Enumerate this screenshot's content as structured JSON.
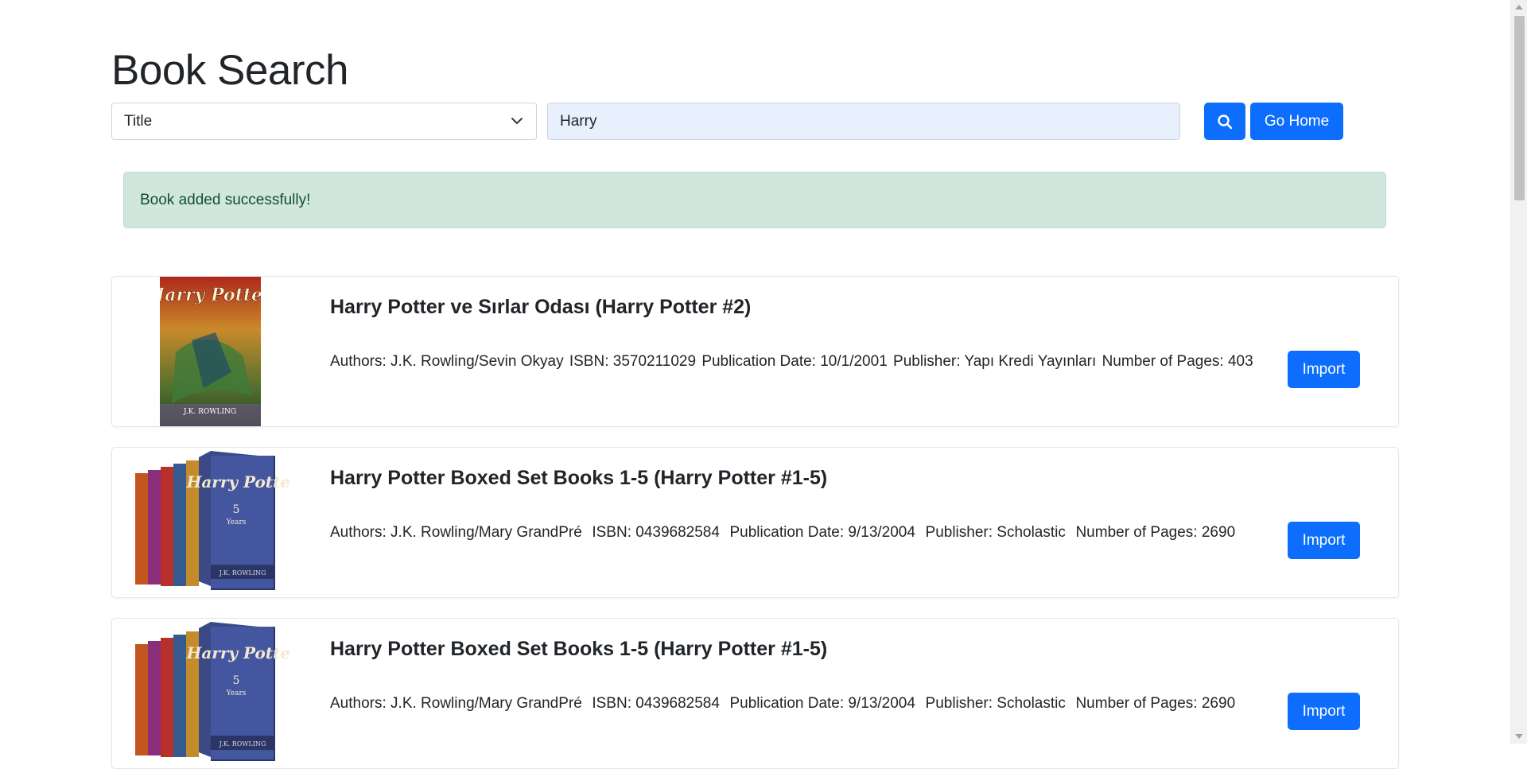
{
  "header": {
    "title": "Book Search"
  },
  "search": {
    "field_selected": "Title",
    "query_value": "Harry",
    "search_icon": "search-icon",
    "go_home_label": "Go Home"
  },
  "alert": {
    "message": "Book added successfully!"
  },
  "colors": {
    "primary": "#0d6efd",
    "alert_bg": "#d1e7dd",
    "alert_text": "#0f5132",
    "input_autofill_bg": "#e8f0fe"
  },
  "results": [
    {
      "title": "Harry Potter ve Sırlar Odası (Harry Potter #2)",
      "authors": "Authors: J.K. Rowling/Sevin Okyay",
      "isbn": "ISBN: 3570211029",
      "publication_date": "Publication Date: 10/1/2001",
      "publisher": "Publisher: Yapı Kredi Yayınları",
      "pages": "Number of Pages: 403",
      "import_label": "Import",
      "cover_text": "Harry Potter"
    },
    {
      "title": "Harry Potter Boxed Set Books 1-5 (Harry Potter #1-5)",
      "authors": "Authors: J.K. Rowling/Mary GrandPré",
      "isbn": "ISBN: 0439682584",
      "publication_date": "Publication Date: 9/13/2004",
      "publisher": "Publisher: Scholastic",
      "pages": "Number of Pages: 2690",
      "import_label": "Import",
      "cover_text": "Harry Potter"
    },
    {
      "title": "Harry Potter Boxed Set Books 1-5 (Harry Potter #1-5)",
      "authors": "Authors: J.K. Rowling/Mary GrandPré",
      "isbn": "ISBN: 0439682584",
      "publication_date": "Publication Date: 9/13/2004",
      "publisher": "Publisher: Scholastic",
      "pages": "Number of Pages: 2690",
      "import_label": "Import",
      "cover_text": "Harry Potter"
    }
  ]
}
